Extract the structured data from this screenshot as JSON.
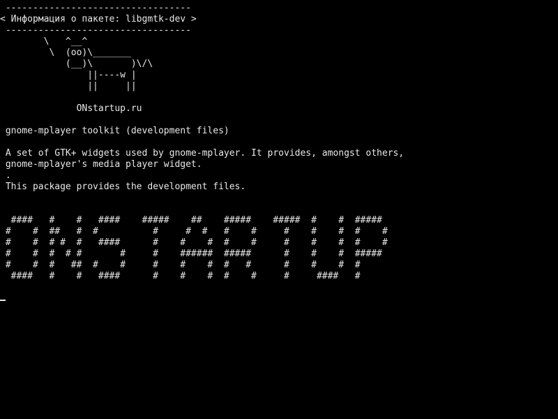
{
  "terminal": {
    "lines": [
      " ----------------------------------",
      "< Информация о пакете: libgmtk-dev >",
      " ----------------------------------",
      "        \\   ^__^",
      "         \\  (oo)\\_______",
      "            (__)\\       )\\/\\",
      "                ||----w |",
      "                ||     ||",
      "",
      "              ONstartup.ru",
      "",
      " gnome-mplayer toolkit (development files)",
      "",
      " A set of GTK+ widgets used by gnome-mplayer. It provides, amongst others,",
      " gnome-mplayer's media player widget.",
      " .",
      " This package provides the development files.",
      "",
      "",
      "  ####   #    #   ####    #####    ##    #####    #####  #    #  #####",
      " #    #  ##   #  #          #     #  #   #    #     #    #    #  #    #",
      " #    #  # #  #   ####      #    #    #  #    #     #    #    #  #    #",
      " #    #  #  # #       #     #    ######  #####      #    #    #  #####",
      " #    #  #   ##  #    #     #    #    #  #   #      #    #    #  #",
      "  ####   #    #   ####      #    #    #  #    #     #     ####   #"
    ]
  }
}
